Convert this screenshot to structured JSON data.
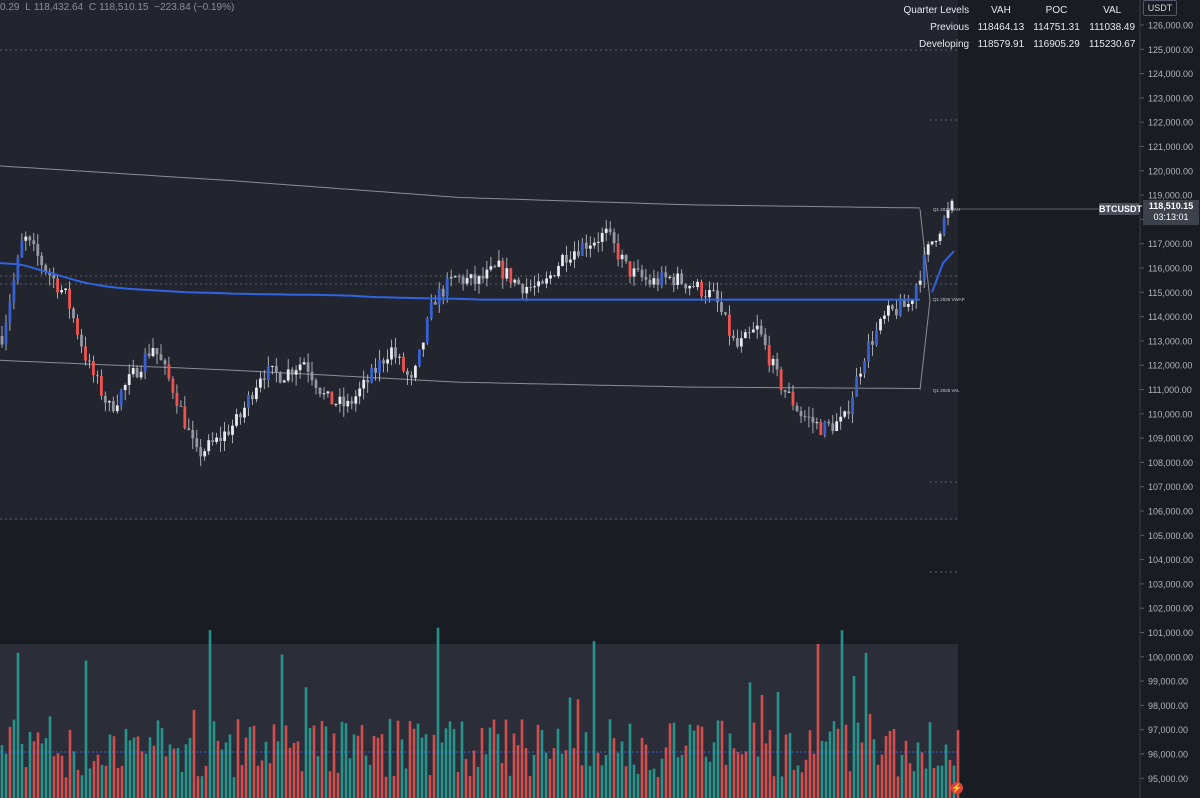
{
  "header": {
    "ohlc_text": [
      {
        "label": "",
        "value": "0.29"
      },
      {
        "label": "L",
        "value": "118,432.64"
      },
      {
        "label": "C",
        "value": "118,510.15"
      },
      {
        "label": "",
        "value": "−223.84 (−0.19%)"
      }
    ]
  },
  "quarter_levels": {
    "title": "Quarter Levels",
    "columns": [
      "VAH",
      "POC",
      "VAL"
    ],
    "rows": [
      {
        "label": "Previous",
        "values": [
          "118464.13",
          "114751.31",
          "111038.49"
        ]
      },
      {
        "label": "Developing",
        "values": [
          "118579.91",
          "116905.29",
          "115230.67"
        ]
      }
    ]
  },
  "price_axis": {
    "unit": "USDT"
  },
  "price_tag": {
    "symbol": "BTCUSDT",
    "price": "118,510.15",
    "countdown": "03:13:01"
  },
  "annotations": {
    "vah": "Q1 2025 VAH",
    "vwap": "Q1 2025 VWAP",
    "val": "Q1 2025 VAL"
  },
  "colors": {
    "up": "#26a69a",
    "down": "#ef5350",
    "wick": "#c8cbd2",
    "vwap": "#2f63e0",
    "blue_candle": "#3860d0",
    "background": "#1a1c23",
    "gray_candle": "#9598a1"
  },
  "chart_data": {
    "type": "candlestick",
    "symbol": "BTCUSDT",
    "ylim": [
      95000,
      126000
    ],
    "y_ticks": [
      126000,
      125000,
      124000,
      123000,
      122000,
      121000,
      120000,
      119000,
      118000,
      117000,
      116000,
      115000,
      114000,
      113000,
      112000,
      111000,
      110000,
      109000,
      108000,
      107000,
      106000,
      105000,
      104000,
      103000,
      102000,
      101000,
      100000,
      99000,
      98000,
      97000,
      96000,
      95000
    ],
    "y_tick_labels": [
      "126,000.00",
      "125,000.00",
      "124,000.00",
      "123,000.00",
      "122,000.00",
      "121,000.00",
      "120,000.00",
      "119,000.00",
      "118,000.00",
      "117,000.00",
      "116,000.00",
      "115,000.00",
      "114,000.00",
      "113,000.00",
      "112,000.00",
      "111,000.00",
      "110,000.00",
      "109,000.00",
      "108,000.00",
      "107,000.00",
      "106,000.00",
      "105,000.00",
      "104,000.00",
      "103,000.00",
      "102,000.00",
      "101,000.00",
      "100,000.00",
      "99,000.00",
      "98,000.00",
      "97,000.00",
      "96,000.00",
      "95,000.00"
    ],
    "close_anchors": [
      113200,
      117300,
      116000,
      114800,
      112000,
      110200,
      111500,
      112800,
      110900,
      108300,
      108900,
      109800,
      111700,
      111600,
      112200,
      110600,
      110300,
      111400,
      112700,
      111200,
      114700,
      115600,
      115400,
      116000,
      115300,
      115100,
      116500,
      117000,
      117400,
      115900,
      115400,
      115600,
      115300,
      114800,
      112700,
      113500,
      111300,
      110000,
      109400,
      109700,
      112600,
      114100,
      114500,
      117000,
      118510
    ],
    "vwap_anchors": [
      116200,
      116150,
      115900,
      115650,
      115400,
      115250,
      115150,
      115100,
      115050,
      115000,
      114980,
      114950,
      114930,
      114920,
      114900,
      114900,
      114880,
      114850,
      114800,
      114780,
      114760,
      114740,
      114730,
      114700,
      114700,
      114700,
      114700,
      114700,
      114700,
      114700,
      114700,
      114700,
      114700,
      114700,
      114700,
      114700,
      114700,
      114700,
      114700,
      114700,
      114700,
      114700,
      114700,
      114700,
      114700
    ],
    "developing_vwap": [
      115000,
      116200,
      116700
    ],
    "volume_profile_lines": {
      "vah_anchors": [
        120200,
        119600,
        118900,
        118600,
        118470
      ],
      "val_anchors": [
        112200,
        111800,
        111300,
        111100,
        111040
      ]
    },
    "volume_scale_max": 100
  }
}
